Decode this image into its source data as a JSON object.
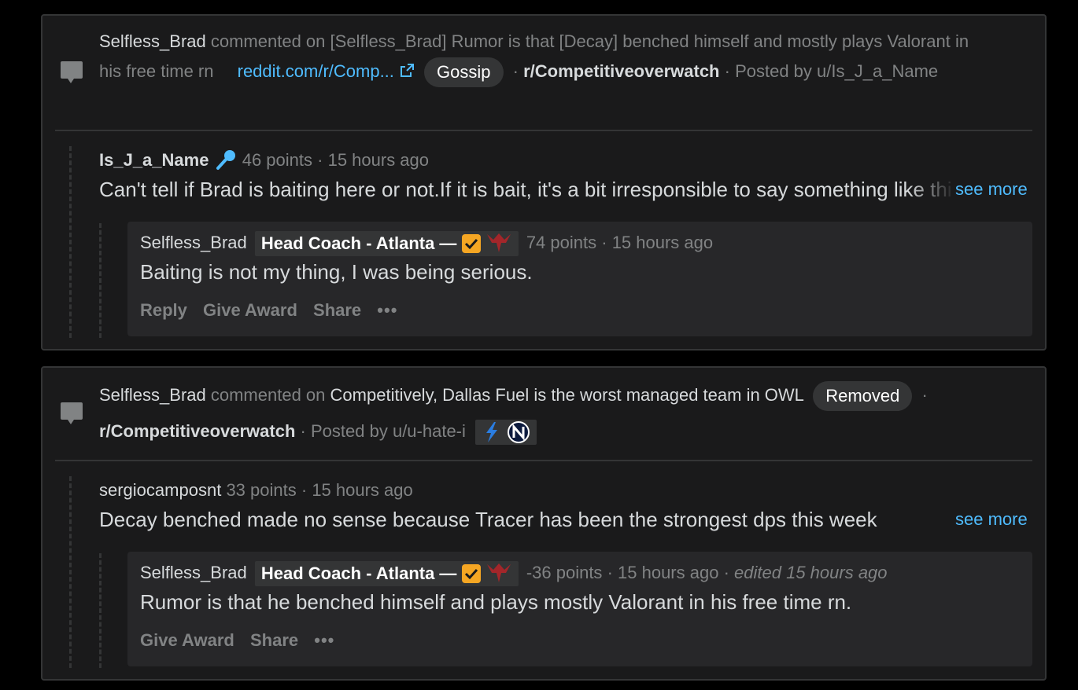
{
  "cards": [
    {
      "author": "Selfless_Brad",
      "commented_on": "commented on",
      "post_title": "[Selfless_Brad] Rumor is that [Decay] benched himself and mostly plays Valorant in his free time rn",
      "link": "reddit.com/r/Comp...",
      "post_flair": "Gossip",
      "subreddit": "r/Competitiveoverwatch",
      "posted_by_prefix": "Posted by",
      "posted_by": "u/Is_J_a_Name",
      "parent": {
        "author": "Is_J_a_Name",
        "points": "46 points",
        "time": "15 hours ago",
        "body": "Can't tell if Brad is baiting here or not.If it is bait, it's a bit irresponsible to say something like this",
        "see_more": "see more"
      },
      "reply": {
        "author": "Selfless_Brad",
        "flair": "Head Coach - Atlanta —",
        "points": "74 points",
        "time": "15 hours ago",
        "edited": "",
        "body": "Baiting is not my thing, I was being serious.",
        "actions": [
          "Reply",
          "Give Award",
          "Share"
        ]
      }
    },
    {
      "author": "Selfless_Brad",
      "commented_on": "commented on",
      "post_title": "Competitively, Dallas Fuel is the worst managed team in OWL",
      "post_flair": "Removed",
      "subreddit": "r/Competitiveoverwatch",
      "posted_by_prefix": "Posted by",
      "posted_by": "u/u-hate-i",
      "parent": {
        "author": "sergiocamposnt",
        "points": "33 points",
        "time": "15 hours ago",
        "body": "Decay benched made no sense because Tracer has been the strongest dps this week",
        "see_more": "see more"
      },
      "reply": {
        "author": "Selfless_Brad",
        "flair": "Head Coach - Atlanta —",
        "points": "-36 points",
        "time": "15 hours ago",
        "edited": "edited 15 hours ago",
        "body": "Rumor is that he benched himself and plays mostly Valorant in his free time rn.",
        "actions": [
          "Give Award",
          "Share"
        ]
      }
    }
  ],
  "separator": "·",
  "more_glyph": "•••",
  "colors": {
    "link": "#4fbcff",
    "flair_check": "#f5a623",
    "atlanta": "#a3262a",
    "dallas": "#2a7de1"
  }
}
